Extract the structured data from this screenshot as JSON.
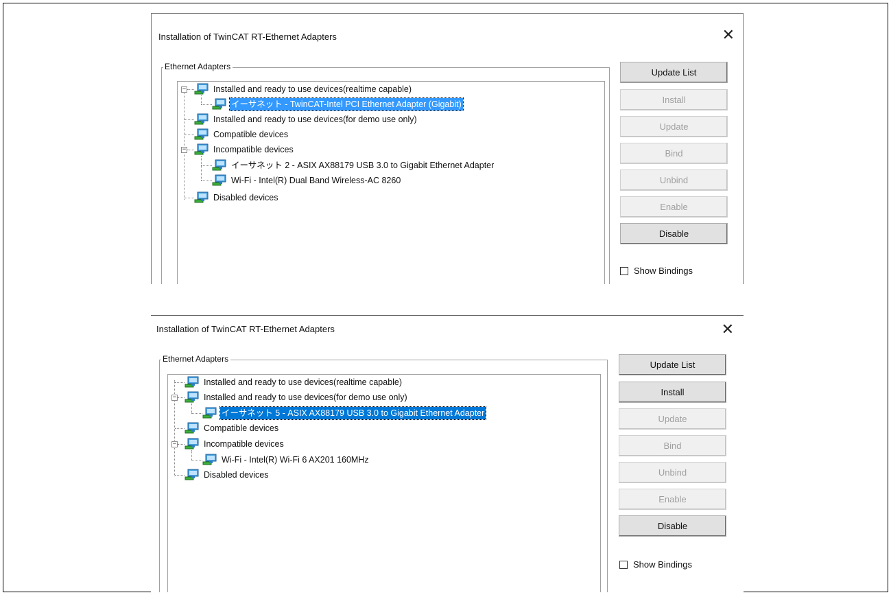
{
  "dialogs": [
    {
      "title": "Installation of TwinCAT RT-Ethernet Adapters",
      "close_glyph": "✕",
      "group_label": "Ethernet Adapters",
      "tree": [
        {
          "label": "Installed and ready to use devices(realtime capable)",
          "expanded": true
        },
        {
          "label": "イーサネット - TwinCAT-Intel PCI Ethernet Adapter (Gigabit)",
          "selected": true
        },
        {
          "label": "Installed and ready to use devices(for demo use only)"
        },
        {
          "label": "Compatible devices"
        },
        {
          "label": "Incompatible devices",
          "expanded": true
        },
        {
          "label": "イーサネット 2 - ASIX AX88179 USB 3.0 to Gigabit Ethernet Adapter"
        },
        {
          "label": "Wi-Fi - Intel(R) Dual Band Wireless-AC 8260"
        },
        {
          "label": "Disabled devices"
        }
      ],
      "buttons": [
        {
          "label": "Update List",
          "enabled": true
        },
        {
          "label": "Install",
          "enabled": false
        },
        {
          "label": "Update",
          "enabled": false
        },
        {
          "label": "Bind",
          "enabled": false
        },
        {
          "label": "Unbind",
          "enabled": false
        },
        {
          "label": "Enable",
          "enabled": false
        },
        {
          "label": "Disable",
          "enabled": true
        }
      ],
      "show_bindings_label": "Show Bindings"
    },
    {
      "title": "Installation of TwinCAT RT-Ethernet Adapters",
      "close_glyph": "✕",
      "group_label": "Ethernet Adapters",
      "tree": [
        {
          "label": "Installed and ready to use devices(realtime capable)"
        },
        {
          "label": "Installed and ready to use devices(for demo use only)",
          "expanded": true
        },
        {
          "label": "イーサネット 5 - ASIX AX88179 USB 3.0 to Gigabit Ethernet Adapter",
          "selected": true
        },
        {
          "label": "Compatible devices"
        },
        {
          "label": "Incompatible devices",
          "expanded": true
        },
        {
          "label": "Wi-Fi - Intel(R) Wi-Fi 6 AX201 160MHz"
        },
        {
          "label": "Disabled devices"
        }
      ],
      "buttons": [
        {
          "label": "Update List",
          "enabled": true
        },
        {
          "label": "Install",
          "enabled": true
        },
        {
          "label": "Update",
          "enabled": false
        },
        {
          "label": "Bind",
          "enabled": false
        },
        {
          "label": "Unbind",
          "enabled": false
        },
        {
          "label": "Enable",
          "enabled": false
        },
        {
          "label": "Disable",
          "enabled": true
        }
      ],
      "show_bindings_label": "Show Bindings"
    }
  ],
  "icons": {
    "tree_node": "network-adapter-icon",
    "expander": "minus-box-icon"
  },
  "colors": {
    "selection_top": "#3399ff",
    "selection_bottom": "#0078d7",
    "disabled_text": "#a0a0a0"
  }
}
